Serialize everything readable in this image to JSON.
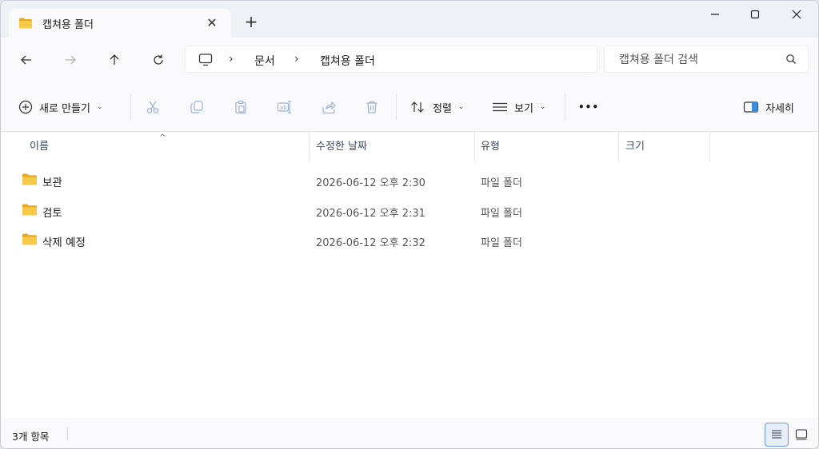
{
  "tab": {
    "title": "캡쳐용 폴더",
    "new_tab": "+"
  },
  "window_controls": {
    "minimize": "—",
    "maximize": "☐",
    "close": "✕"
  },
  "address": {
    "crumbs": [
      "문서",
      "캡쳐용 폴더"
    ]
  },
  "search": {
    "placeholder": "캡쳐용 폴더 검색"
  },
  "commands": {
    "new_label": "새로 만들기",
    "sort_label": "정렬",
    "view_label": "보기",
    "more_label": "•••",
    "details_label": "자세히"
  },
  "columns": [
    "이름",
    "수정한 날짜",
    "유형",
    "크기"
  ],
  "files": [
    {
      "name": "보관",
      "date": "2026-06-12 오후 2:30",
      "type": "파일 폴더"
    },
    {
      "name": "검토",
      "date": "2026-06-12 오후 2:31",
      "type": "파일 폴더"
    },
    {
      "name": "삭제 예정",
      "date": "2026-06-12 오후 2:32",
      "type": "파일 폴더"
    }
  ],
  "status": {
    "count_text": "3개 항목"
  },
  "colors": {
    "folder": "#f7c948",
    "accent": "#6a9bd8",
    "header_text": "#3b4a66"
  }
}
